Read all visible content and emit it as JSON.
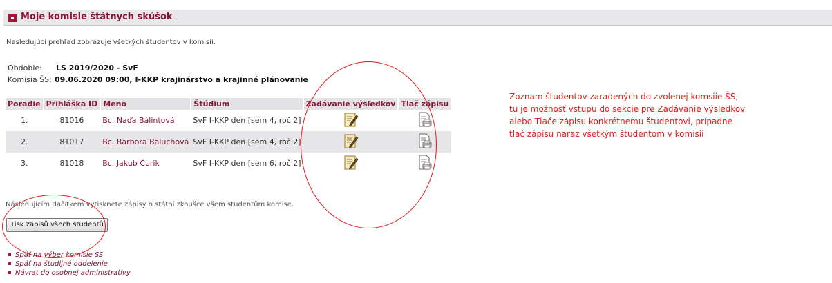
{
  "page": {
    "title": "Moje komisie štátnych skúšok",
    "intro": "Nasledujúci prehľad zobrazuje všetkých študentov v komisii."
  },
  "info": {
    "period_label": "Obdobie:",
    "period_value": "LS 2019/2020 - SvF",
    "committee_label": "Komisia ŠS:",
    "committee_value": "09.06.2020 09:00, I-KKP krajinárstvo a krajinné plánovanie"
  },
  "table": {
    "headers": [
      "Poradie",
      "Prihláška ID",
      "Meno",
      "Štúdium",
      "Zadávanie výsledkov",
      "Tlač zápisu"
    ],
    "rows": [
      {
        "order": "1.",
        "id": "81016",
        "name": "Bc. Naďa Bálintová",
        "study": "SvF I-KKP den [sem 4, roč 2]"
      },
      {
        "order": "2.",
        "id": "81017",
        "name": "Bc. Barbora Baluchová",
        "study": "SvF I-KKP den [sem 4, roč 2]"
      },
      {
        "order": "3.",
        "id": "81018",
        "name": "Bc. Jakub Čurik",
        "study": "SvF I-KKP den [sem 6, roč 2]"
      }
    ]
  },
  "bottom_text": "Následujícím tlačítkem vytisknete zápisy o státní zkoušce všem studentům komise.",
  "print_all_button": "Tisk zápisů všech studentů",
  "links": [
    "Späť na výber komisie ŠS",
    "Späť na študijné oddelenie",
    "Návrat do osobnej administratívy"
  ],
  "annotation_lines": [
    "Zoznam študentov zaradených do zvolenej komsiie ŠS,",
    "tu je možnosť vstupu do sekcie pre Zadávanie výsledkov",
    "alebo Tlače zápisu konkrétnemu študentovi, prípadne",
    "tlač zápisu naraz všetkým študentom v komisii"
  ],
  "colors": {
    "accent": "#8a1538",
    "annotation": "#e01c1c",
    "header_bg": "#e3e3e6"
  },
  "icons": {
    "edit": "edit-results-icon",
    "print": "print-record-icon"
  }
}
